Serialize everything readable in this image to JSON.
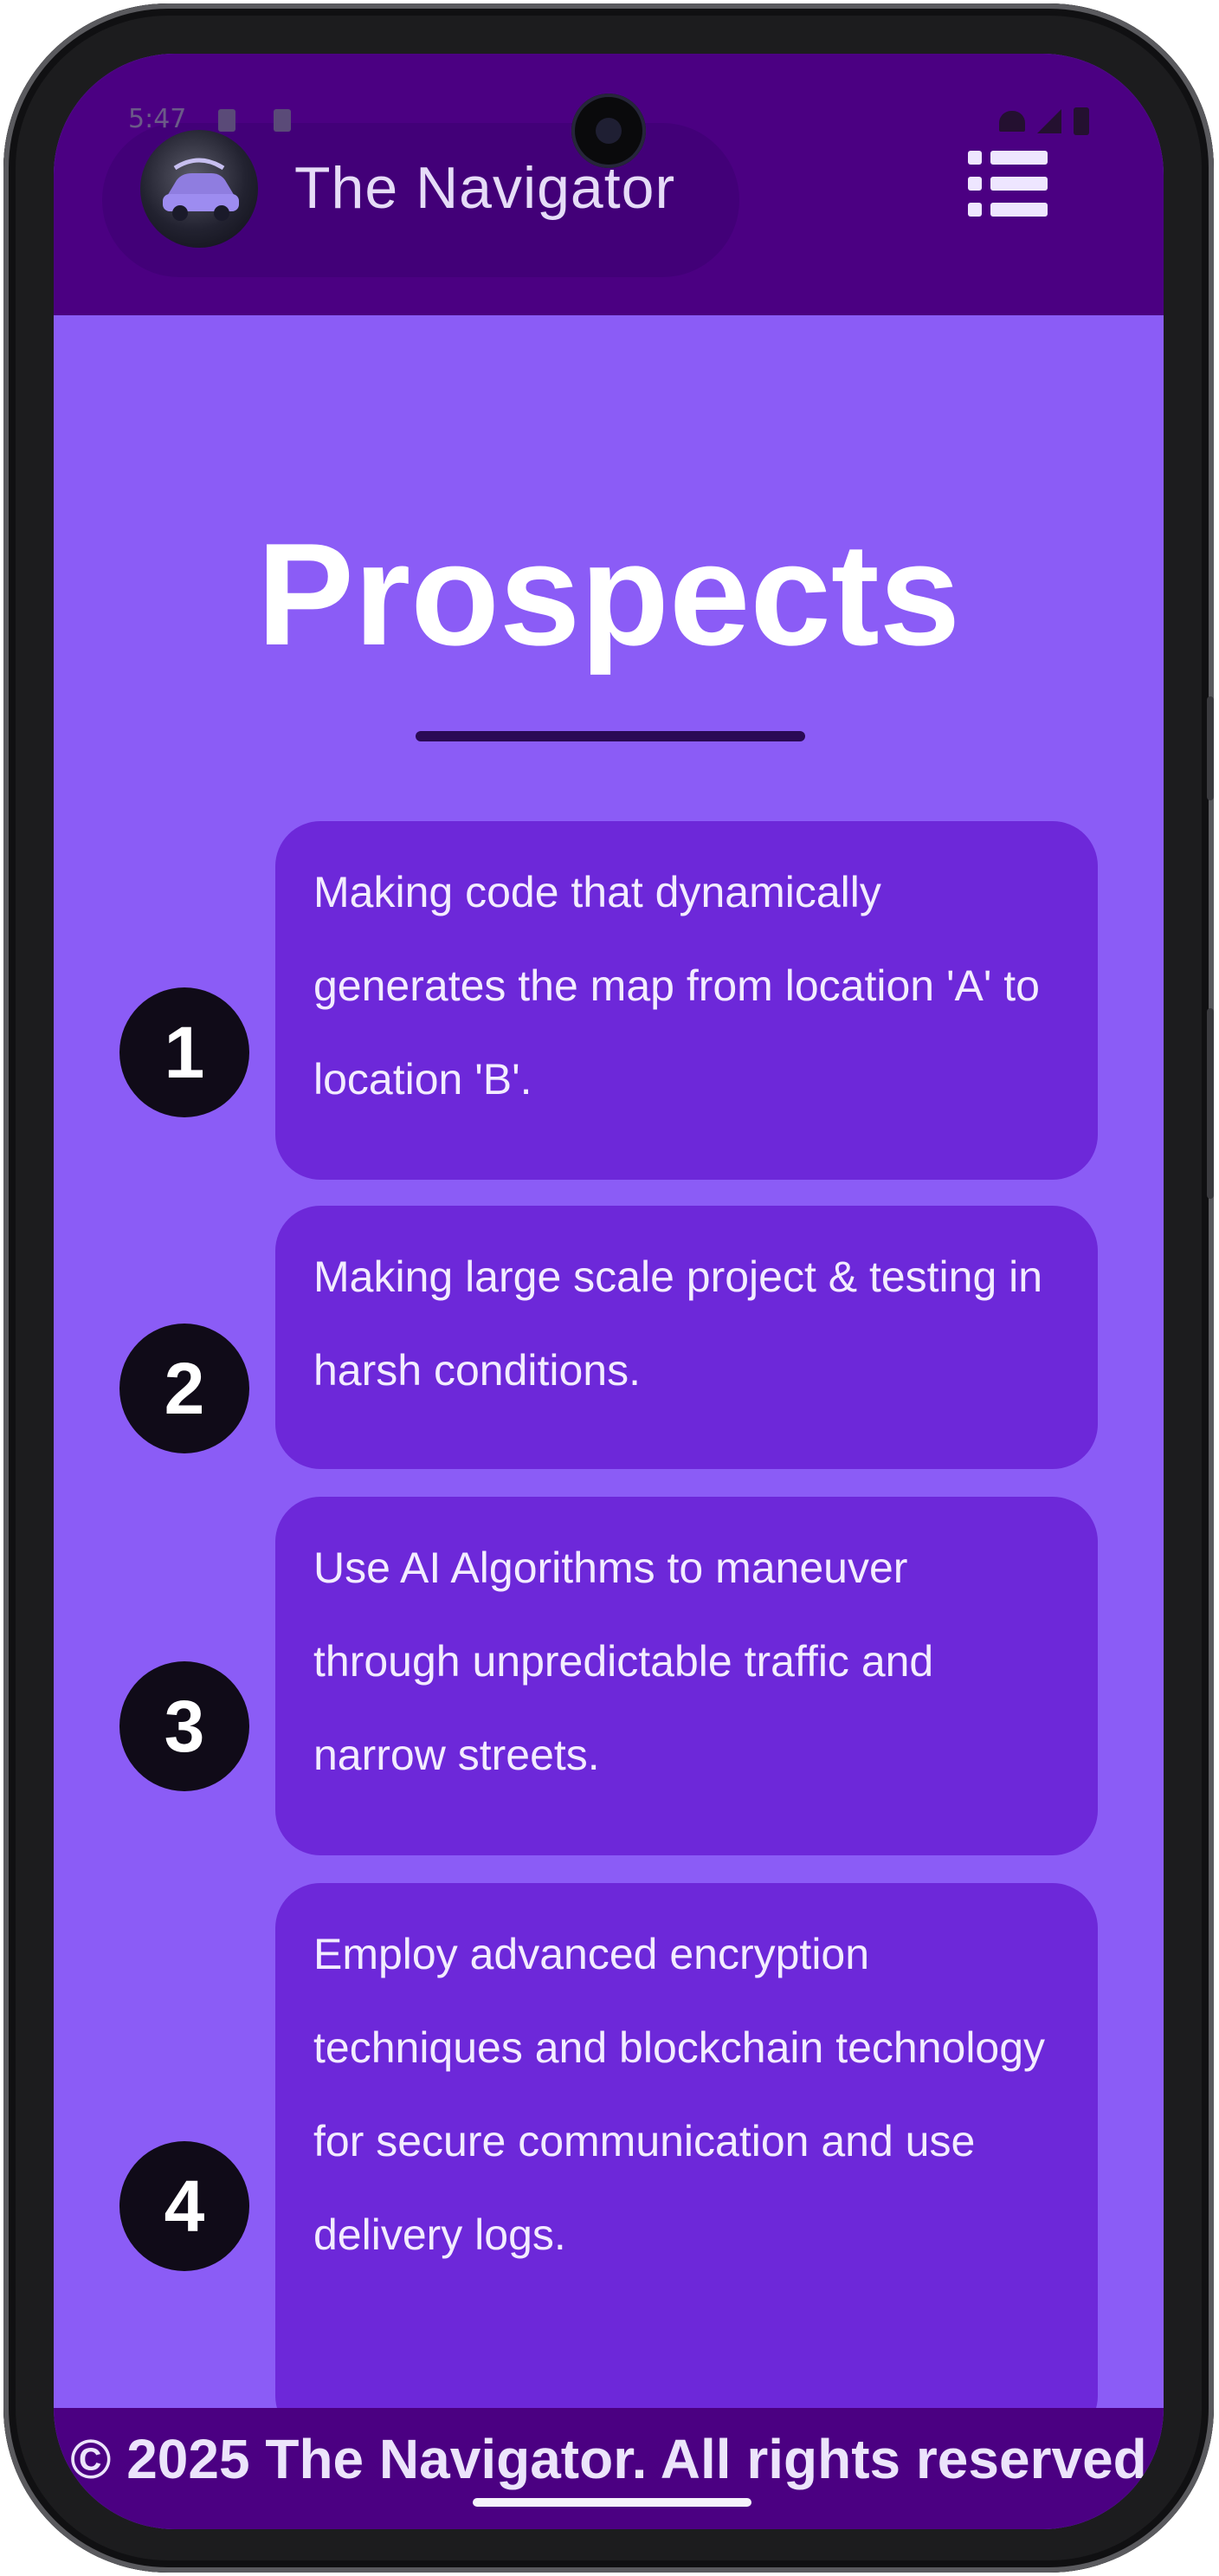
{
  "status_bar": {
    "time": "5:47"
  },
  "header": {
    "brand_name": "The Navigator",
    "logo_icon": "car-logo-icon",
    "menu_icon": "list-menu-icon",
    "background_color": "#4b0082"
  },
  "main": {
    "title": "Prospects",
    "background_color": "#8b5cf6",
    "card_color": "#6d28d9",
    "items": [
      {
        "number": "1",
        "text": "Making code that dynamically generates the map from location 'A' to location 'B'."
      },
      {
        "number": "2",
        "text": "Making large scale project & testing in harsh conditions."
      },
      {
        "number": "3",
        "text": "Use AI Algorithms to maneuver through unpredictable traffic and narrow streets."
      },
      {
        "number": "4",
        "text": "Employ advanced encryption techniques and blockchain technology for secure communication and use delivery logs."
      }
    ]
  },
  "footer": {
    "text": "© 2025 The Navigator. All rights reserved"
  }
}
